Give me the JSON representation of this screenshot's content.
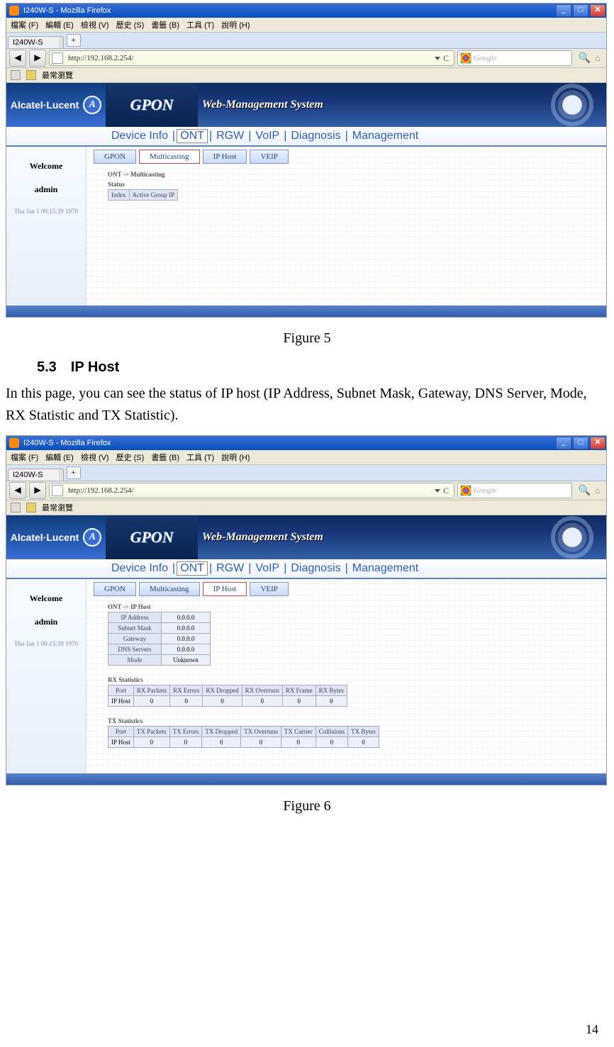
{
  "browser": {
    "window_title": "I240W-S - Mozilla Firefox",
    "menu": {
      "file": "檔案 (F)",
      "edit": "編輯 (E)",
      "view": "檢視 (V)",
      "history": "歷史 (S)",
      "bookmarks": "書籤 (B)",
      "tools": "工具 (T)",
      "help": "說明 (H)"
    },
    "tab_label": "I240W-S",
    "tab_plus": "+",
    "nav": {
      "back": "◀",
      "forward": "▶",
      "url": "http://192.168.2.254/",
      "reload": "C",
      "search_placeholder": "Google",
      "magnifier": "🔍",
      "home": "⌂"
    },
    "bookmarks_bar": "最常瀏覽",
    "win": {
      "min": "_",
      "max": "□",
      "close": "✕"
    }
  },
  "app": {
    "brand": "Alcatel·Lucent",
    "brand_glyph": "A",
    "product": "GPON",
    "subtitle": "Web-Management System",
    "menu": {
      "device": "Device Info",
      "ont": "ONT",
      "rgw": "RGW",
      "voip": "VoIP",
      "diag": "Diagnosis",
      "mgmt": "Management",
      "sep": "|"
    },
    "tabs": {
      "gpon": "GPON",
      "multicast": "Multicasting",
      "iphost": "IP Host",
      "veip": "VEIP"
    },
    "sidebar": {
      "welcome": "Welcome",
      "user": "admin",
      "ts": "Thu Jan 1 00:15:39 1970"
    }
  },
  "shot1": {
    "crumb": "ONT -> Multicasting",
    "status_label": "Status",
    "status_table": {
      "c1": "Index",
      "c2": "Active Group IP"
    }
  },
  "shot2": {
    "crumb": "ONT -> IP Host",
    "kv": {
      "ip_label": "IP Address",
      "ip_val": "0.0.0.0",
      "mask_label": "Subnet Mask",
      "mask_val": "0.0.0.0",
      "gw_label": "Gateway",
      "gw_val": "0.0.0.0",
      "dns_label": "DNS Servers",
      "dns_val": "0.0.0.0",
      "mode_label": "Mode",
      "mode_val": "Unknown"
    },
    "rx": {
      "title": "RX Statistics",
      "h": {
        "port": "Port",
        "pk": "RX Packets",
        "er": "RX Errors",
        "dr": "RX Dropped",
        "ov": "RX Overruns",
        "fr": "RX Frame",
        "by": "RX Bytes"
      },
      "row": {
        "port": "IP Host",
        "pk": "0",
        "er": "0",
        "dr": "0",
        "ov": "0",
        "fr": "0",
        "by": "0"
      }
    },
    "tx": {
      "title": "TX Statistics",
      "h": {
        "port": "Port",
        "pk": "TX Packets",
        "er": "TX Errors",
        "dr": "TX Dropped",
        "ov": "TX Overruns",
        "ca": "TX Carrier",
        "col": "Collisions",
        "by": "TX Bytes"
      },
      "row": {
        "port": "IP Host",
        "pk": "0",
        "er": "0",
        "dr": "0",
        "ov": "0",
        "ca": "0",
        "col": "0",
        "by": "0"
      }
    }
  },
  "doc": {
    "fig5": "Figure 5",
    "sec": "5.3 IP Host",
    "para": "In this page, you can see the status of IP host (IP Address, Subnet Mask, Gateway, DNS Server, Mode, RX Statistic and TX Statistic).",
    "fig6": "Figure 6",
    "pagenum": "14"
  }
}
